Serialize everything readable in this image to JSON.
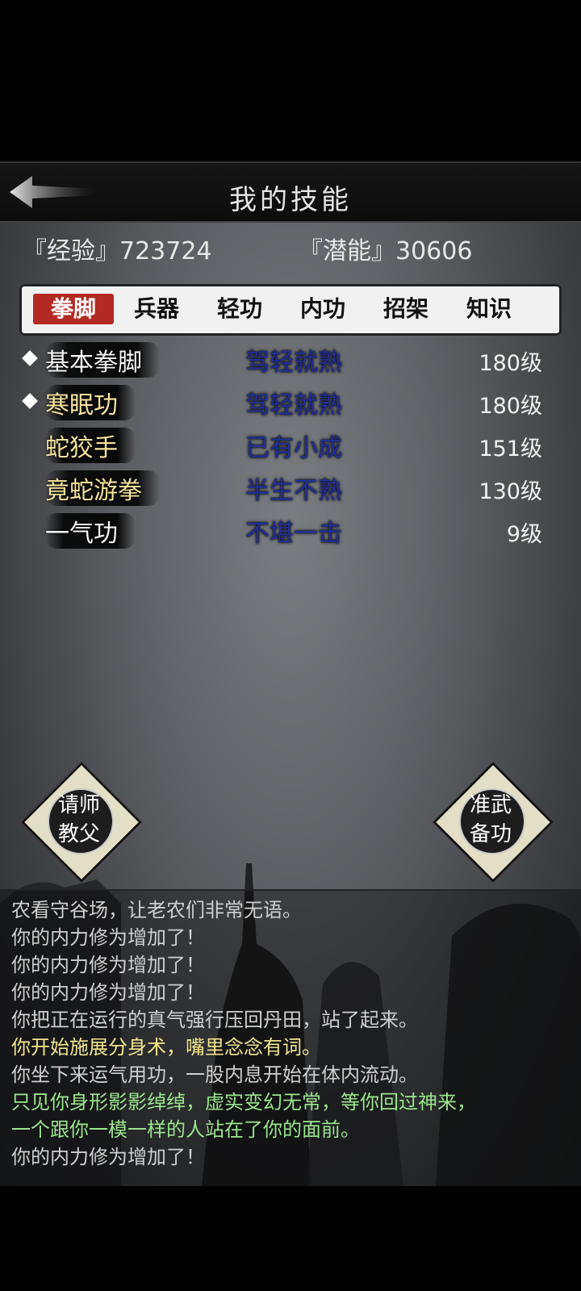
{
  "header": {
    "title": "我的技能"
  },
  "stats": {
    "experience": "『经验』723724",
    "potential": "『潜能』30606"
  },
  "tabs": [
    "拳脚",
    "兵器",
    "轻功",
    "内功",
    "招架",
    "知识"
  ],
  "skills": [
    {
      "name": "基本拳脚",
      "proficiency": "驾轻就熟",
      "level": "180级"
    },
    {
      "name": "寒眠功",
      "proficiency": "驾轻就熟",
      "level": "180级"
    },
    {
      "name": "蛇狡手",
      "proficiency": "已有小成",
      "level": "151级"
    },
    {
      "name": "竟蛇游拳",
      "proficiency": "半生不熟",
      "level": "130级"
    },
    {
      "name": "一气功",
      "proficiency": "不堪一击",
      "level": "9级"
    }
  ],
  "buttons": {
    "left_line1": "请师",
    "left_line2": "教父",
    "right_line1": "准武",
    "right_line2": "备功"
  },
  "log": [
    {
      "text": "农看守谷场，让老农们非常无语。",
      "color": "#cfcfcf"
    },
    {
      "text": "你的内力修为增加了！",
      "color": "#cfcfcf"
    },
    {
      "text": "你的内力修为增加了！",
      "color": "#cfcfcf"
    },
    {
      "text": "你的内力修为增加了！",
      "color": "#cfcfcf"
    },
    {
      "text": "你把正在运行的真气强行压回丹田，站了起来。",
      "color": "#cfcfcf"
    },
    {
      "text": "你开始施展分身术，嘴里念念有词。",
      "color": "#f3e58c"
    },
    {
      "text": "你坐下来运气用功，一股内息开始在体内流动。",
      "color": "#cfcfcf"
    },
    {
      "text": "只见你身形影影绰绰，虚实变幻无常，等你回过神来，",
      "color": "#9be68d"
    },
    {
      "text": "一个跟你一模一样的人站在了你的面前。",
      "color": "#9be68d"
    },
    {
      "text": "你的内力修为增加了！",
      "color": "#cfcfcf"
    }
  ]
}
